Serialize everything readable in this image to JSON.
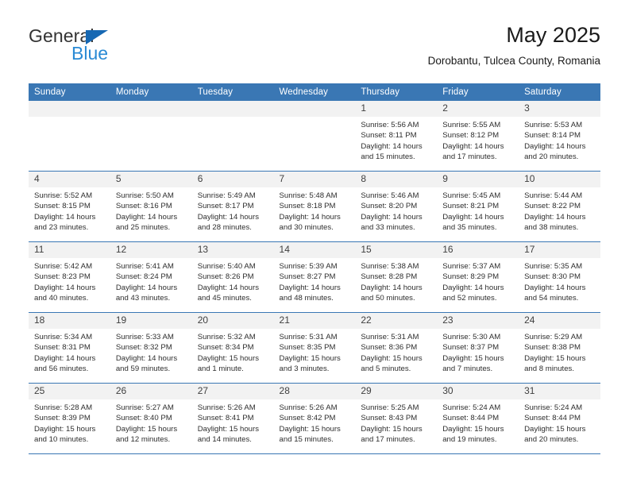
{
  "brand": {
    "name_part1": "General",
    "name_part2": "Blue",
    "triangle_icon": "triangle-icon",
    "color_dark": "#333333",
    "color_blue": "#2a8ad4",
    "triangle_color": "#1668b3"
  },
  "header": {
    "title": "May 2025",
    "subtitle": "Dorobantu, Tulcea County, Romania"
  },
  "theme": {
    "header_row_bg": "#3a77b4",
    "header_row_text": "#ffffff",
    "daynum_bg": "#f2f2f2",
    "row_rule": "#3a77b4",
    "cell_text": "#2e2e2e"
  },
  "calendar": {
    "weekday_headers": [
      "Sunday",
      "Monday",
      "Tuesday",
      "Wednesday",
      "Thursday",
      "Friday",
      "Saturday"
    ],
    "weeks": [
      [
        {
          "day": "",
          "lines": []
        },
        {
          "day": "",
          "lines": []
        },
        {
          "day": "",
          "lines": []
        },
        {
          "day": "",
          "lines": []
        },
        {
          "day": "1",
          "lines": [
            "Sunrise: 5:56 AM",
            "Sunset: 8:11 PM",
            "Daylight: 14 hours",
            "and 15 minutes."
          ]
        },
        {
          "day": "2",
          "lines": [
            "Sunrise: 5:55 AM",
            "Sunset: 8:12 PM",
            "Daylight: 14 hours",
            "and 17 minutes."
          ]
        },
        {
          "day": "3",
          "lines": [
            "Sunrise: 5:53 AM",
            "Sunset: 8:14 PM",
            "Daylight: 14 hours",
            "and 20 minutes."
          ]
        }
      ],
      [
        {
          "day": "4",
          "lines": [
            "Sunrise: 5:52 AM",
            "Sunset: 8:15 PM",
            "Daylight: 14 hours",
            "and 23 minutes."
          ]
        },
        {
          "day": "5",
          "lines": [
            "Sunrise: 5:50 AM",
            "Sunset: 8:16 PM",
            "Daylight: 14 hours",
            "and 25 minutes."
          ]
        },
        {
          "day": "6",
          "lines": [
            "Sunrise: 5:49 AM",
            "Sunset: 8:17 PM",
            "Daylight: 14 hours",
            "and 28 minutes."
          ]
        },
        {
          "day": "7",
          "lines": [
            "Sunrise: 5:48 AM",
            "Sunset: 8:18 PM",
            "Daylight: 14 hours",
            "and 30 minutes."
          ]
        },
        {
          "day": "8",
          "lines": [
            "Sunrise: 5:46 AM",
            "Sunset: 8:20 PM",
            "Daylight: 14 hours",
            "and 33 minutes."
          ]
        },
        {
          "day": "9",
          "lines": [
            "Sunrise: 5:45 AM",
            "Sunset: 8:21 PM",
            "Daylight: 14 hours",
            "and 35 minutes."
          ]
        },
        {
          "day": "10",
          "lines": [
            "Sunrise: 5:44 AM",
            "Sunset: 8:22 PM",
            "Daylight: 14 hours",
            "and 38 minutes."
          ]
        }
      ],
      [
        {
          "day": "11",
          "lines": [
            "Sunrise: 5:42 AM",
            "Sunset: 8:23 PM",
            "Daylight: 14 hours",
            "and 40 minutes."
          ]
        },
        {
          "day": "12",
          "lines": [
            "Sunrise: 5:41 AM",
            "Sunset: 8:24 PM",
            "Daylight: 14 hours",
            "and 43 minutes."
          ]
        },
        {
          "day": "13",
          "lines": [
            "Sunrise: 5:40 AM",
            "Sunset: 8:26 PM",
            "Daylight: 14 hours",
            "and 45 minutes."
          ]
        },
        {
          "day": "14",
          "lines": [
            "Sunrise: 5:39 AM",
            "Sunset: 8:27 PM",
            "Daylight: 14 hours",
            "and 48 minutes."
          ]
        },
        {
          "day": "15",
          "lines": [
            "Sunrise: 5:38 AM",
            "Sunset: 8:28 PM",
            "Daylight: 14 hours",
            "and 50 minutes."
          ]
        },
        {
          "day": "16",
          "lines": [
            "Sunrise: 5:37 AM",
            "Sunset: 8:29 PM",
            "Daylight: 14 hours",
            "and 52 minutes."
          ]
        },
        {
          "day": "17",
          "lines": [
            "Sunrise: 5:35 AM",
            "Sunset: 8:30 PM",
            "Daylight: 14 hours",
            "and 54 minutes."
          ]
        }
      ],
      [
        {
          "day": "18",
          "lines": [
            "Sunrise: 5:34 AM",
            "Sunset: 8:31 PM",
            "Daylight: 14 hours",
            "and 56 minutes."
          ]
        },
        {
          "day": "19",
          "lines": [
            "Sunrise: 5:33 AM",
            "Sunset: 8:32 PM",
            "Daylight: 14 hours",
            "and 59 minutes."
          ]
        },
        {
          "day": "20",
          "lines": [
            "Sunrise: 5:32 AM",
            "Sunset: 8:34 PM",
            "Daylight: 15 hours",
            "and 1 minute."
          ]
        },
        {
          "day": "21",
          "lines": [
            "Sunrise: 5:31 AM",
            "Sunset: 8:35 PM",
            "Daylight: 15 hours",
            "and 3 minutes."
          ]
        },
        {
          "day": "22",
          "lines": [
            "Sunrise: 5:31 AM",
            "Sunset: 8:36 PM",
            "Daylight: 15 hours",
            "and 5 minutes."
          ]
        },
        {
          "day": "23",
          "lines": [
            "Sunrise: 5:30 AM",
            "Sunset: 8:37 PM",
            "Daylight: 15 hours",
            "and 7 minutes."
          ]
        },
        {
          "day": "24",
          "lines": [
            "Sunrise: 5:29 AM",
            "Sunset: 8:38 PM",
            "Daylight: 15 hours",
            "and 8 minutes."
          ]
        }
      ],
      [
        {
          "day": "25",
          "lines": [
            "Sunrise: 5:28 AM",
            "Sunset: 8:39 PM",
            "Daylight: 15 hours",
            "and 10 minutes."
          ]
        },
        {
          "day": "26",
          "lines": [
            "Sunrise: 5:27 AM",
            "Sunset: 8:40 PM",
            "Daylight: 15 hours",
            "and 12 minutes."
          ]
        },
        {
          "day": "27",
          "lines": [
            "Sunrise: 5:26 AM",
            "Sunset: 8:41 PM",
            "Daylight: 15 hours",
            "and 14 minutes."
          ]
        },
        {
          "day": "28",
          "lines": [
            "Sunrise: 5:26 AM",
            "Sunset: 8:42 PM",
            "Daylight: 15 hours",
            "and 15 minutes."
          ]
        },
        {
          "day": "29",
          "lines": [
            "Sunrise: 5:25 AM",
            "Sunset: 8:43 PM",
            "Daylight: 15 hours",
            "and 17 minutes."
          ]
        },
        {
          "day": "30",
          "lines": [
            "Sunrise: 5:24 AM",
            "Sunset: 8:44 PM",
            "Daylight: 15 hours",
            "and 19 minutes."
          ]
        },
        {
          "day": "31",
          "lines": [
            "Sunrise: 5:24 AM",
            "Sunset: 8:44 PM",
            "Daylight: 15 hours",
            "and 20 minutes."
          ]
        }
      ]
    ]
  }
}
